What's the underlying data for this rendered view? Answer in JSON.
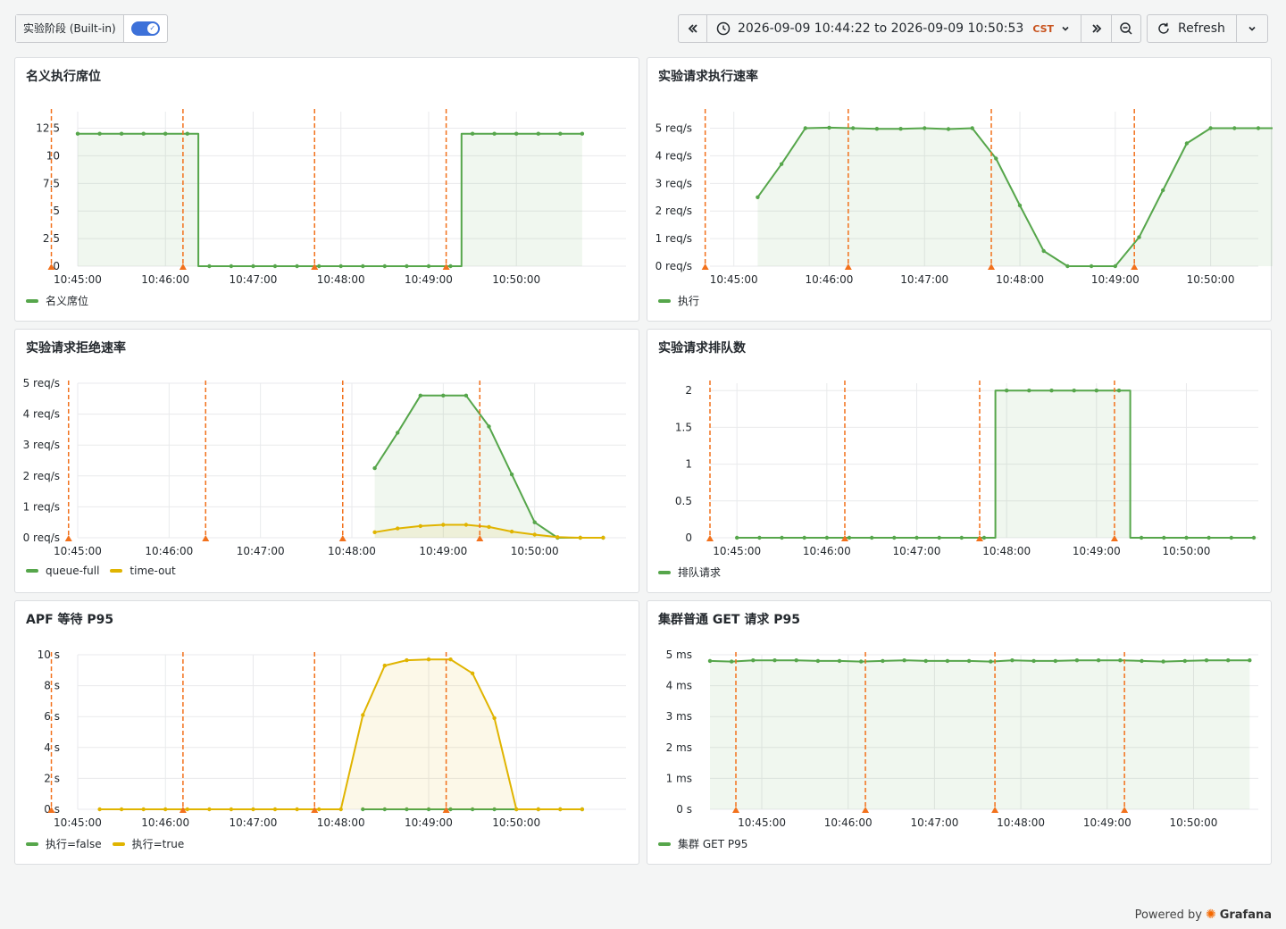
{
  "toolbar": {
    "variable_label": "实验阶段 (Built-in)",
    "toggle_on": true,
    "time_range": "2026-09-09 10:44:22 to 2026-09-09 10:50:53",
    "timezone": "CST",
    "refresh_label": "Refresh"
  },
  "footer": {
    "powered_by": "Powered by",
    "brand": "Grafana"
  },
  "colors": {
    "green": "#56a64b",
    "yellow": "#e0b400",
    "annotation": "#f2711c"
  },
  "panels": [
    {
      "title": "名义执行席位",
      "legend": [
        {
          "name": "名义席位",
          "color": "#56a64b"
        }
      ],
      "chart_data": {
        "type": "line",
        "step": true,
        "fill": true,
        "x_ticks": [
          "10:45:00",
          "10:46:00",
          "10:47:00",
          "10:48:00",
          "10:49:00",
          "10:50:00"
        ],
        "xlim": [
          0,
          6.25
        ],
        "y_ticks": [
          "0",
          "2.5",
          "5",
          "7.5",
          "10",
          "12.5"
        ],
        "ylim": [
          0,
          14
        ],
        "annotations": [
          -0.3,
          1.2,
          2.7,
          4.2
        ],
        "series": [
          {
            "name": "名义席位",
            "color": "#56a64b",
            "x": [
              0,
              0.25,
              0.5,
              0.75,
              1.0,
              1.25,
              1.5,
              1.75,
              2.0,
              2.25,
              2.5,
              2.75,
              3.0,
              3.25,
              3.5,
              3.75,
              4.0,
              4.25,
              4.5,
              4.75,
              5.0,
              5.25,
              5.5,
              5.75
            ],
            "y": [
              12,
              12,
              12,
              12,
              12,
              12,
              0,
              0,
              0,
              0,
              0,
              0,
              0,
              0,
              0,
              0,
              0,
              0,
              12,
              12,
              12,
              12,
              12,
              12
            ]
          }
        ]
      }
    },
    {
      "title": "实验请求执行速率",
      "legend": [
        {
          "name": "执行",
          "color": "#56a64b"
        }
      ],
      "chart_data": {
        "type": "line",
        "fill": true,
        "x_ticks": [
          "10:45:00",
          "10:46:00",
          "10:47:00",
          "10:48:00",
          "10:49:00",
          "10:50:00"
        ],
        "xlim": [
          -0.25,
          5.5
        ],
        "y_ticks": [
          "0 req/s",
          "1 req/s",
          "2 req/s",
          "3 req/s",
          "4 req/s",
          "5 req/s"
        ],
        "ylim": [
          0,
          5.6
        ],
        "annotations": [
          -0.3,
          1.2,
          2.7,
          4.2
        ],
        "series": [
          {
            "name": "执行",
            "color": "#56a64b",
            "x": [
              0.25,
              0.5,
              0.75,
              1.0,
              1.25,
              1.5,
              1.75,
              2.0,
              2.25,
              2.5,
              2.75,
              3.0,
              3.25,
              3.5,
              3.75,
              4.0,
              4.25,
              4.5,
              4.75,
              5.0,
              5.25,
              5.5,
              5.75
            ],
            "y": [
              2.5,
              3.7,
              5.0,
              5.02,
              5.0,
              4.98,
              4.98,
              5.0,
              4.97,
              5.0,
              3.9,
              2.2,
              0.55,
              0.0,
              0.0,
              0.0,
              1.05,
              2.75,
              4.45,
              5.0,
              5.0,
              5.0,
              5.0
            ]
          }
        ]
      }
    },
    {
      "title": "实验请求拒绝速率",
      "legend": [
        {
          "name": "queue-full",
          "color": "#56a64b"
        },
        {
          "name": "time-out",
          "color": "#e0b400"
        }
      ],
      "chart_data": {
        "type": "line",
        "fill": true,
        "x_ticks": [
          "10:45:00",
          "10:46:00",
          "10:47:00",
          "10:48:00",
          "10:49:00",
          "10:50:00"
        ],
        "xlim": [
          0,
          6
        ],
        "y_ticks": [
          "0 req/s",
          "1 req/s",
          "2 req/s",
          "3 req/s",
          "4 req/s",
          "5 req/s"
        ],
        "ylim": [
          0,
          5
        ],
        "annotations": [
          -0.1,
          1.4,
          2.9,
          4.4
        ],
        "series": [
          {
            "name": "queue-full",
            "color": "#56a64b",
            "x": [
              3.25,
              3.5,
              3.75,
              4.0,
              4.25,
              4.5,
              4.75,
              5.0,
              5.25,
              5.5,
              5.75
            ],
            "y": [
              2.25,
              3.4,
              4.6,
              4.6,
              4.6,
              3.6,
              2.05,
              0.5,
              0.0,
              0.0,
              0.0
            ]
          },
          {
            "name": "time-out",
            "color": "#e0b400",
            "x": [
              3.25,
              3.5,
              3.75,
              4.0,
              4.25,
              4.5,
              4.75,
              5.0,
              5.25,
              5.5,
              5.75
            ],
            "y": [
              0.18,
              0.3,
              0.38,
              0.42,
              0.42,
              0.35,
              0.2,
              0.1,
              0.02,
              0.0,
              0.0
            ]
          }
        ]
      }
    },
    {
      "title": "实验请求排队数",
      "legend": [
        {
          "name": "排队请求",
          "color": "#56a64b"
        }
      ],
      "chart_data": {
        "type": "line",
        "step": true,
        "fill": true,
        "x_ticks": [
          "10:45:00",
          "10:46:00",
          "10:47:00",
          "10:48:00",
          "10:49:00",
          "10:50:00"
        ],
        "xlim": [
          -0.3,
          5.8
        ],
        "y_ticks": [
          "0",
          "0.5",
          "1",
          "1.5",
          "2"
        ],
        "ylim": [
          0,
          2.1
        ],
        "annotations": [
          -0.3,
          1.2,
          2.7,
          4.2
        ],
        "series": [
          {
            "name": "排队请求",
            "color": "#56a64b",
            "x": [
              0,
              0.25,
              0.5,
              0.75,
              1.0,
              1.25,
              1.5,
              1.75,
              2.0,
              2.25,
              2.5,
              2.75,
              3.0,
              3.25,
              3.5,
              3.75,
              4.0,
              4.25,
              4.5,
              4.75,
              5.0,
              5.25,
              5.5,
              5.75
            ],
            "y": [
              0,
              0,
              0,
              0,
              0,
              0,
              0,
              0,
              0,
              0,
              0,
              0,
              2,
              2,
              2,
              2,
              2,
              2,
              0,
              0,
              0,
              0,
              0,
              0
            ]
          }
        ]
      }
    },
    {
      "title": "APF 等待 P95",
      "legend": [
        {
          "name": "执行=false",
          "color": "#56a64b"
        },
        {
          "name": "执行=true",
          "color": "#e0b400"
        }
      ],
      "chart_data": {
        "type": "line",
        "fill": true,
        "x_ticks": [
          "10:45:00",
          "10:46:00",
          "10:47:00",
          "10:48:00",
          "10:49:00",
          "10:50:00"
        ],
        "xlim": [
          0,
          6.25
        ],
        "y_ticks": [
          "0 s",
          "2 s",
          "4 s",
          "6 s",
          "8 s",
          "10 s"
        ],
        "ylim": [
          0,
          10
        ],
        "annotations": [
          -0.3,
          1.2,
          2.7,
          4.2
        ],
        "series": [
          {
            "name": "执行=false",
            "color": "#56a64b",
            "x": [
              3.25,
              3.5,
              3.75,
              4.0,
              4.25,
              4.5,
              4.75,
              5.0,
              5.25,
              5.5,
              5.75
            ],
            "y": [
              0,
              0,
              0,
              0,
              0,
              0,
              0,
              0,
              0,
              0,
              0
            ]
          },
          {
            "name": "执行=true",
            "color": "#e0b400",
            "x": [
              0.25,
              0.5,
              0.75,
              1.0,
              1.25,
              1.5,
              1.75,
              2.0,
              2.25,
              2.5,
              2.75,
              3.0,
              3.25,
              3.5,
              3.75,
              4.0,
              4.25,
              4.5,
              4.75,
              5.0,
              5.25,
              5.5,
              5.75
            ],
            "y": [
              0,
              0,
              0,
              0,
              0,
              0,
              0,
              0,
              0,
              0,
              0,
              0,
              6.1,
              9.3,
              9.65,
              9.7,
              9.7,
              8.8,
              5.9,
              0,
              0,
              0,
              0
            ]
          }
        ]
      }
    },
    {
      "title": "集群普通 GET 请求 P95",
      "legend": [
        {
          "name": "集群 GET P95",
          "color": "#56a64b"
        }
      ],
      "chart_data": {
        "type": "line",
        "fill": true,
        "x_ticks": [
          "10:45:00",
          "10:46:00",
          "10:47:00",
          "10:48:00",
          "10:49:00",
          "10:50:00"
        ],
        "xlim": [
          -0.6,
          5.75
        ],
        "y_ticks": [
          "0 s",
          "1 ms",
          "2 ms",
          "3 ms",
          "4 ms",
          "5 ms"
        ],
        "ylim": [
          0,
          5
        ],
        "annotations": [
          -0.3,
          1.2,
          2.7,
          4.2
        ],
        "series": [
          {
            "name": "集群 GET P95",
            "color": "#56a64b",
            "x": [
              -0.6,
              -0.35,
              -0.1,
              0.15,
              0.4,
              0.65,
              0.9,
              1.15,
              1.4,
              1.65,
              1.9,
              2.15,
              2.4,
              2.65,
              2.9,
              3.15,
              3.4,
              3.65,
              3.9,
              4.15,
              4.4,
              4.65,
              4.9,
              5.15,
              5.4,
              5.65
            ],
            "y": [
              4.8,
              4.78,
              4.82,
              4.82,
              4.82,
              4.8,
              4.8,
              4.78,
              4.8,
              4.82,
              4.8,
              4.8,
              4.8,
              4.78,
              4.82,
              4.8,
              4.8,
              4.82,
              4.82,
              4.82,
              4.8,
              4.78,
              4.8,
              4.82,
              4.82,
              4.82
            ]
          }
        ]
      }
    }
  ]
}
